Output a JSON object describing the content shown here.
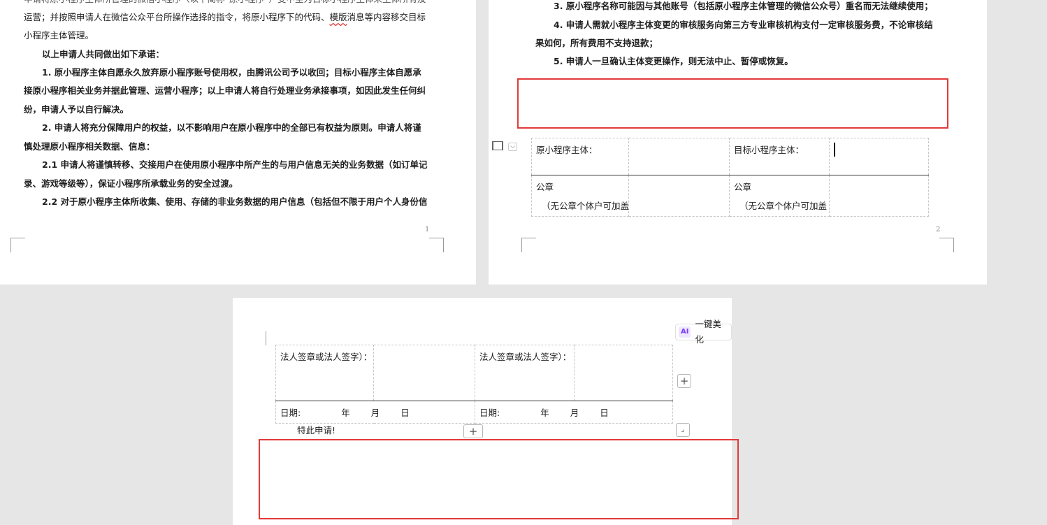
{
  "page1": {
    "lines": [
      "申请将原小程序主体所管理的微信小程序（以下简称“原小程序”）变中至为目标小程序主体来主体所有及",
      "运营；并按照申请人在微信公众平台所操作选择的指令，将原小程序下的代码、",
      "消息等内容移交目标",
      "小程序主体管理。",
      "以上申请人共同做出如下承诺：",
      "1. 原小程序主体自愿永久放弃原小程序账号使用权，由腾讯公司予以收回；目标小程序主体自愿承",
      "接原小程序相关业务并据此管理、运营小程序；以上申请人将自行处理业务承接事项，如因此发生任何纠",
      "纷，申请人予以自行解决。",
      "2. 申请人将充分保障用户的权益，以不影响用户在原小程序中的全部已有权益为原则。申请人将谨",
      "慎处理原小程序相关数据、信息：",
      "2.1 申请人将谨慎转移、交接用户在使用原小程序中所产生的与用户信息无关的业务数据（如订单记",
      "录、游戏等级等），保证小程序所承载业务的安全过渡。",
      "2.2 对于原小程序主体所收集、使用、存储的非业务数据的用户信息（包括但不限于用户个人身份信"
    ],
    "wavy_word": "模版",
    "page_number": "1"
  },
  "page2": {
    "lines": [
      "3. 原小程序名称可能因与其他账号（包括原小程序主体管理的微信公众号）重名而无法继续使用；",
      "4. 申请人需就小程序主体变更的审核服务向第三方专业审核机构支付一定审核服务费，不论审核结",
      "果如何，所有费用不支持退款；",
      "5. 申请人一旦确认主体变更操作，则无法中止、暂停或恢复。"
    ],
    "table": {
      "left_header": "原小程序主体：",
      "right_header": "目标小程序主体：",
      "left_seal": "公章",
      "left_seal_note": "（无公章个体户可加盖",
      "right_seal": "公章",
      "right_seal_note": "（无公章个体户可加盖"
    },
    "page_number": "2"
  },
  "page3": {
    "ai_label": "AI",
    "ai_button": "一键美化",
    "table": {
      "left_sign": "法人签章或法人签字）：",
      "right_sign": "法人签章或法人签字）：",
      "date_label": "日期:",
      "year": "年",
      "month": "月",
      "day": "日"
    },
    "closing": "特此申请!",
    "plus_symbol": "+"
  },
  "colors": {
    "highlight_box": "#e23a3a",
    "background": "#e6e6e6",
    "page": "#ffffff"
  }
}
